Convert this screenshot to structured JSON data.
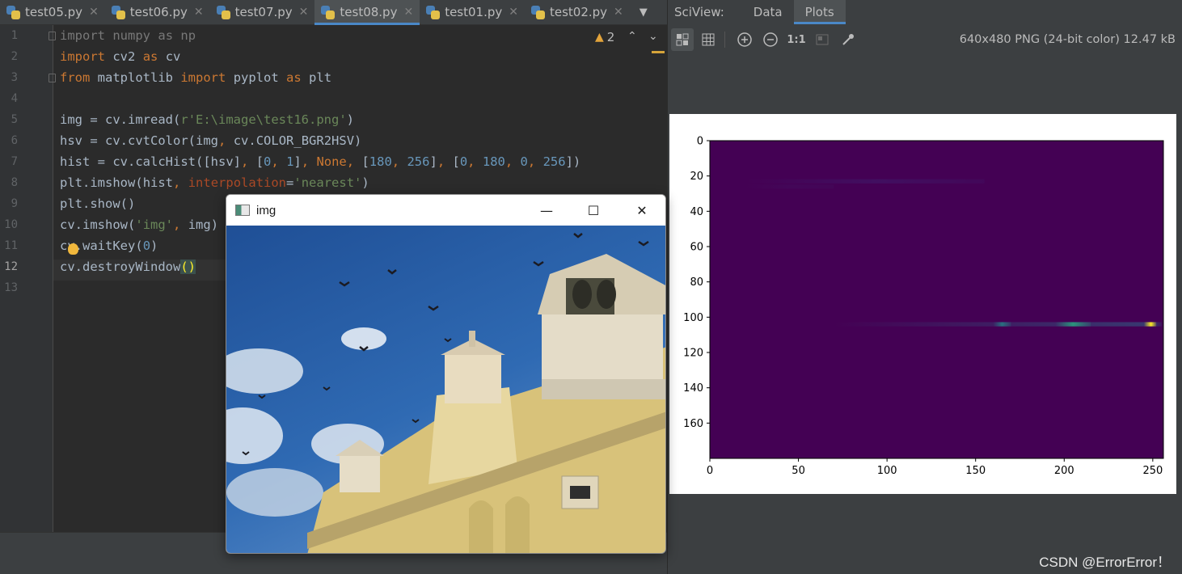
{
  "editor_tabs": [
    {
      "label": "test05.py",
      "active": false
    },
    {
      "label": "test06.py",
      "active": false
    },
    {
      "label": "test07.py",
      "active": false
    },
    {
      "label": "test08.py",
      "active": true
    },
    {
      "label": "test01.py",
      "active": false
    },
    {
      "label": "test02.py",
      "active": false
    }
  ],
  "editor": {
    "line_numbers": [
      "1",
      "2",
      "3",
      "4",
      "5",
      "6",
      "7",
      "8",
      "9",
      "10",
      "11",
      "12",
      "13"
    ],
    "current_line": "12",
    "warning_count": "2",
    "code_lines": [
      "import numpy as np",
      "import cv2 as cv",
      "from matplotlib import pyplot as plt",
      "",
      "img = cv.imread(r'E:\\image\\test16.png')",
      "hsv = cv.cvtColor(img, cv.COLOR_BGR2HSV)",
      "hist = cv.calcHist([hsv], [0, 1], None, [180, 256], [0, 180, 0, 256])",
      "plt.imshow(hist, interpolation='nearest')",
      "plt.show()",
      "cv.imshow('img', img)",
      "cv.waitKey(0)",
      "cv.destroyWindow()",
      ""
    ]
  },
  "sciview": {
    "title": "SciView:",
    "tabs": [
      {
        "label": "Data",
        "active": false
      },
      {
        "label": "Plots",
        "active": true
      }
    ],
    "toolbar": {
      "actual_size_label": "1:1",
      "icons": [
        "fit-icon",
        "grid-icon",
        "zoom-in-icon",
        "zoom-out-icon",
        "actual-size-icon",
        "background-icon",
        "color-picker-icon"
      ]
    },
    "image_info": "640x480 PNG (24-bit color) 12.47 kB"
  },
  "chart_data": {
    "type": "heatmap",
    "title": "",
    "xlabel": "",
    "ylabel": "",
    "xlim": [
      0,
      256
    ],
    "ylim": [
      180,
      0
    ],
    "x_ticks": [
      "0",
      "50",
      "100",
      "150",
      "200",
      "250"
    ],
    "x_tick_values": [
      0,
      50,
      100,
      150,
      200,
      250
    ],
    "y_ticks": [
      "0",
      "20",
      "40",
      "60",
      "80",
      "100",
      "120",
      "140",
      "160"
    ],
    "y_tick_values": [
      0,
      20,
      40,
      60,
      80,
      100,
      120,
      140,
      160
    ],
    "background_color": "#440154",
    "streaks": [
      {
        "row": 23,
        "x_start": 20,
        "x_end": 155,
        "peak_x": 95,
        "color": "#3b2a77",
        "intensity": 0.35
      },
      {
        "row": 26,
        "x_start": 20,
        "x_end": 70,
        "peak_x": 45,
        "color": "#3f1f68",
        "intensity": 0.2
      },
      {
        "row": 104,
        "x_start": 70,
        "x_end": 255,
        "peak_x": 250,
        "color": "#2c728e",
        "intensity": 0.5
      },
      {
        "row": 104,
        "x_start": 160,
        "x_end": 170,
        "peak_x": 165,
        "color": "#21918c",
        "intensity": 0.7
      },
      {
        "row": 104,
        "x_start": 195,
        "x_end": 215,
        "peak_x": 205,
        "color": "#27ad81",
        "intensity": 0.8
      },
      {
        "row": 104,
        "x_start": 245,
        "x_end": 252,
        "peak_x": 249,
        "color": "#fde725",
        "intensity": 1.0
      }
    ]
  },
  "img_window": {
    "title": "img",
    "minimize_label": "—",
    "maximize_label": "☐",
    "close_label": "✕"
  },
  "watermark": "CSDN @ErrorError！",
  "colors": {
    "editor_bg": "#2b2b2b",
    "panel_bg": "#3c3f41",
    "keyword": "#cc7832",
    "string": "#6a8759",
    "number": "#6897bb",
    "accent": "#4a88c7"
  }
}
